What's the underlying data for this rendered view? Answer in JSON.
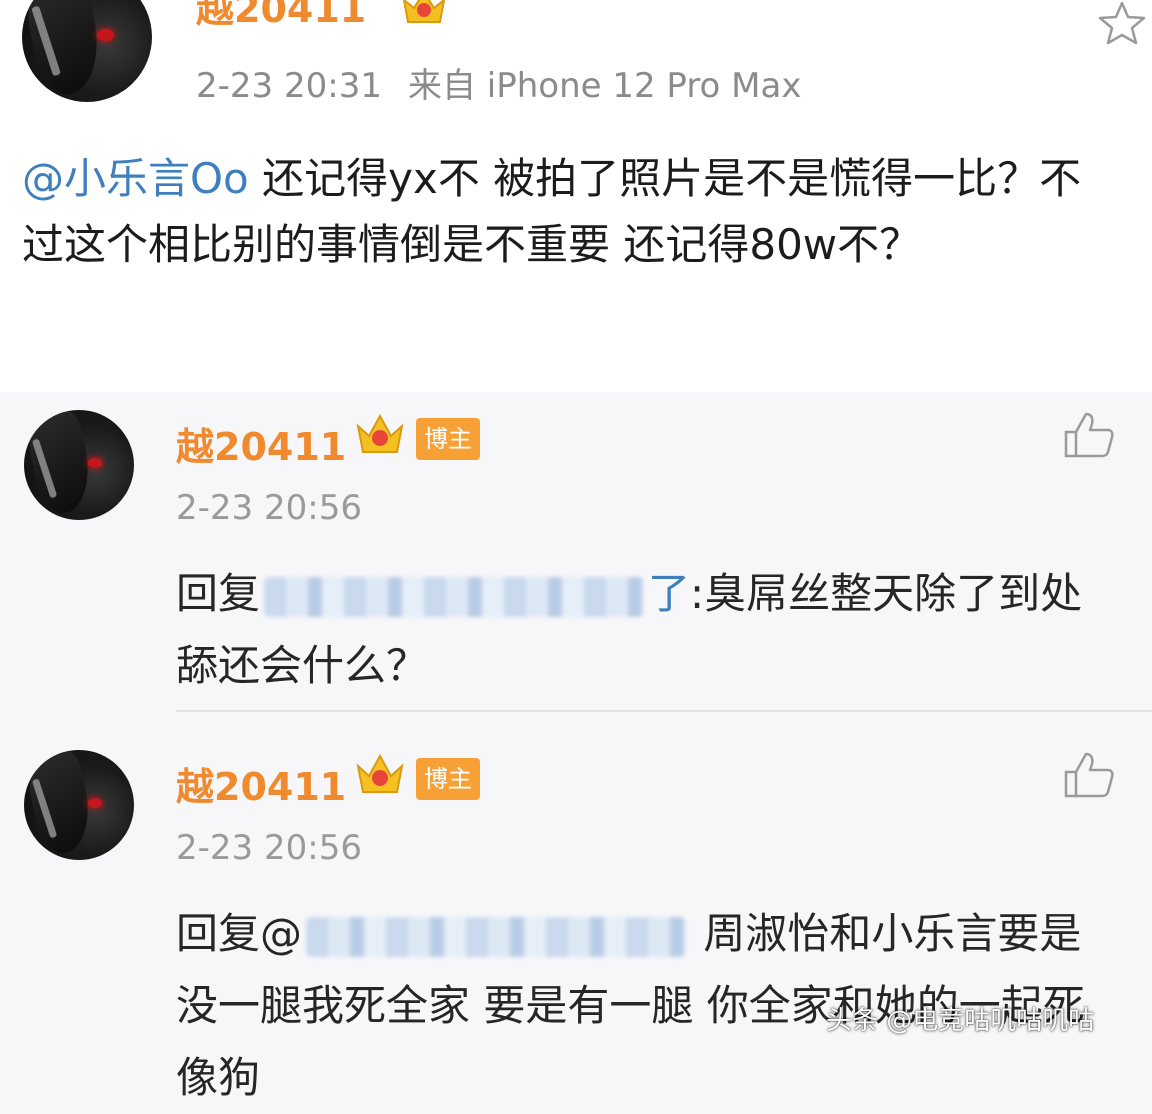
{
  "post": {
    "author": "越20411",
    "time": "2-23 20:31",
    "source": "来自 iPhone 12 Pro Max",
    "mention": "@小乐言Oo",
    "text": " 还记得yx不 被拍了照片是不是慌得一比？不过这个相比别的事情倒是不重要 还记得80w不？"
  },
  "comments": [
    {
      "author": "越20411",
      "badge": "博主",
      "time": "2-23 20:56",
      "reply_prefix": "回复",
      "reply_tail": "了",
      "text": ":臭屌丝整天除了到处舔还会什么？"
    },
    {
      "author": "越20411",
      "badge": "博主",
      "time": "2-23 20:56",
      "reply_prefix": "回复@",
      "text": " 周淑怡和小乐言要是没一腿我死全家 要是有一腿 你全家和她的一起死 像狗"
    }
  ],
  "watermark": "头条 @电竞咕叽咕叽咕",
  "colors": {
    "username": "#f08a2f",
    "mention": "#3f7fbe",
    "badge": "#f7a035",
    "meta": "#8b8b8b"
  },
  "icons": [
    "crown-icon",
    "star-icon",
    "thumbs-up-icon"
  ]
}
